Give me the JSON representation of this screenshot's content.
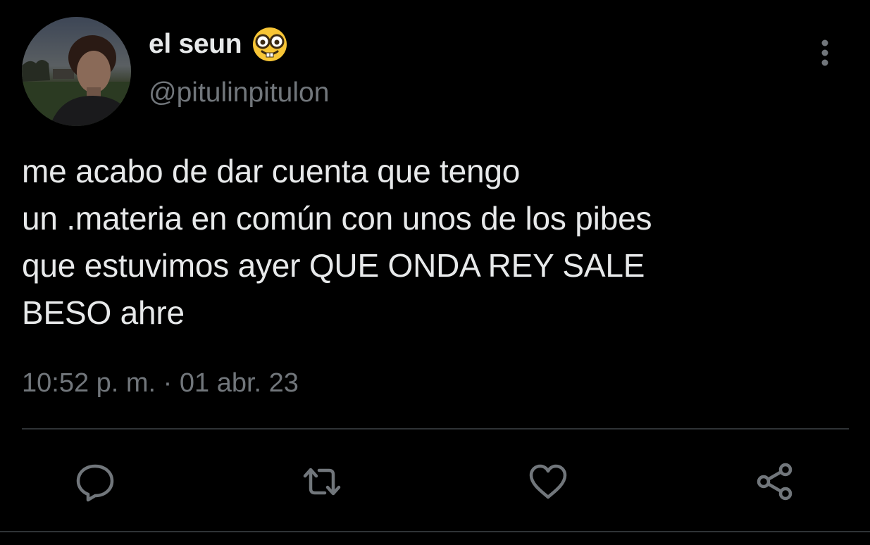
{
  "user": {
    "display_name": "el seun",
    "name_emoji": "nerd-face-emoji",
    "handle": "@pitulinpitulon",
    "avatar": "profile-photo"
  },
  "tweet": {
    "text": "me acabo de dar cuenta que tengo\nun .materia en común con unos de los pibes\nque estuvimos ayer QUE ONDA REY SALE\nBESO ahre",
    "timestamp": "10:52 p. m. · 01 abr. 23"
  },
  "actions": {
    "reply_icon": "comment-icon",
    "retweet_icon": "retweet-icon",
    "like_icon": "heart-icon",
    "share_icon": "share-icon",
    "more_icon": "more-vertical-icon"
  },
  "colors": {
    "background": "#000000",
    "primary_text": "#e7e9ea",
    "secondary_text": "#71767b",
    "divider": "#2f3336"
  }
}
